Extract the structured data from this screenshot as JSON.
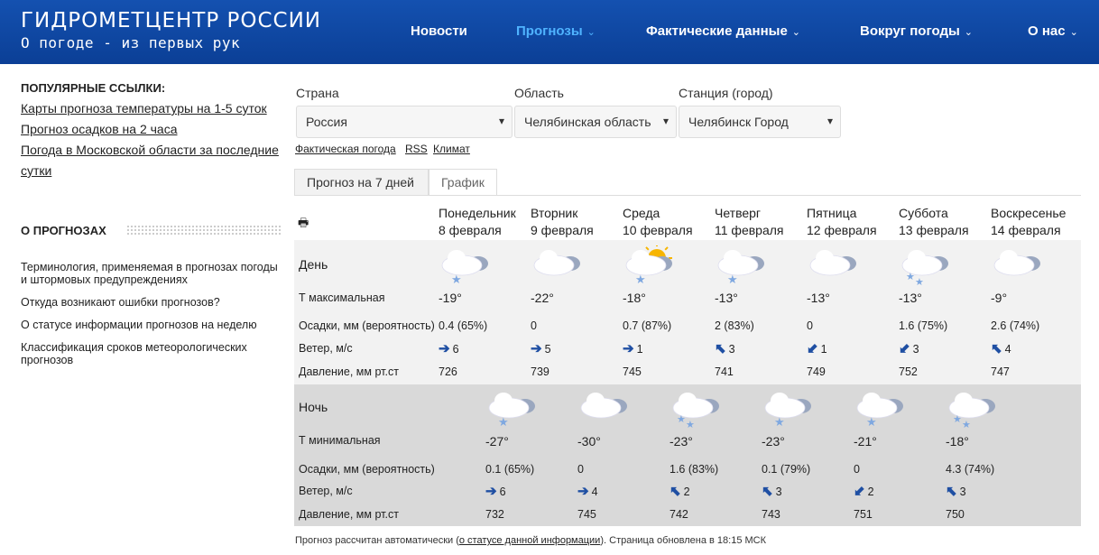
{
  "header": {
    "logo_title": "ГИДРОМЕТЦЕНТР РОССИИ",
    "logo_subtitle": "О погоде - из первых рук",
    "nav": [
      {
        "label": "Новости",
        "chev": ""
      },
      {
        "label": "Прогнозы",
        "chev": "⌄"
      },
      {
        "label": "Фактические данные",
        "chev": "⌄"
      },
      {
        "label": "Вокруг погоды",
        "chev": "⌄"
      },
      {
        "label": "О нас",
        "chev": "⌄"
      }
    ]
  },
  "sidebar": {
    "popular_title": "ПОПУЛЯРНЫЕ ССЫЛКИ:",
    "popular_links": [
      "Карты прогноза температуры на 1-5 суток",
      "Прогноз осадков на 2 часа",
      "Погода в Московской области за последние сутки"
    ],
    "about_title": "О ПРОГНОЗАХ",
    "about_links": [
      "Терминология, применяемая в прогнозах погоды и штормовых предупреждениях",
      "Откуда возникают ошибки прогнозов?",
      "О статусе информации прогнозов на неделю",
      "Классификация сроков метеорологических прогнозов"
    ]
  },
  "filters": {
    "country_label": "Страна",
    "country_value": "Россия",
    "region_label": "Область",
    "region_value": "Челябинская область",
    "station_label": "Станция (город)",
    "station_value": "Челябинск Город"
  },
  "links": {
    "actual": "Фактическая погода",
    "rss": "RSS",
    "climate": "Климат"
  },
  "tabs": {
    "forecast": "Прогноз на 7 дней",
    "chart": "График"
  },
  "days": [
    {
      "name": "Понедельник",
      "date": "8 февраля",
      "tmax": "-19°",
      "precip": "0.4 (65%)",
      "wind": "6",
      "wind_arrow": "➔",
      "pressure": "726",
      "icon": "cloud-snow"
    },
    {
      "name": "Вторник",
      "date": "9 февраля",
      "tmax": "-22°",
      "precip": "0",
      "wind": "5",
      "wind_arrow": "➔",
      "pressure": "739",
      "icon": "cloud"
    },
    {
      "name": "Среда",
      "date": "10 февраля",
      "tmax": "-18°",
      "precip": "0.7 (87%)",
      "wind": "1",
      "wind_arrow": "➔",
      "pressure": "745",
      "icon": "sun-cloud-snow"
    },
    {
      "name": "Четверг",
      "date": "11 февраля",
      "tmax": "-13°",
      "precip": "2 (83%)",
      "wind": "3",
      "wind_arrow": "⬉",
      "pressure": "741",
      "icon": "cloud-snow"
    },
    {
      "name": "Пятница",
      "date": "12 февраля",
      "tmax": "-13°",
      "precip": "0",
      "wind": "1",
      "wind_arrow": "⬋",
      "pressure": "749",
      "icon": "cloud"
    },
    {
      "name": "Суббота",
      "date": "13 февраля",
      "tmax": "-13°",
      "precip": "1.6 (75%)",
      "wind": "3",
      "wind_arrow": "⬋",
      "pressure": "752",
      "icon": "cloud-snow2"
    },
    {
      "name": "Воскресенье",
      "date": "14 февраля",
      "tmax": "-9°",
      "precip": "2.6 (74%)",
      "wind": "4",
      "wind_arrow": "⬉",
      "pressure": "747",
      "icon": "cloud"
    }
  ],
  "nights": [
    {
      "tmin": "-27°",
      "precip": "0.1 (65%)",
      "wind": "6",
      "wind_arrow": "➔",
      "pressure": "732",
      "icon": "cloud-snow"
    },
    {
      "tmin": "-30°",
      "precip": "0",
      "wind": "4",
      "wind_arrow": "➔",
      "pressure": "745",
      "icon": "moon-cloud"
    },
    {
      "tmin": "-23°",
      "precip": "1.6 (83%)",
      "wind": "2",
      "wind_arrow": "⬉",
      "pressure": "742",
      "icon": "cloud-snow2"
    },
    {
      "tmin": "-23°",
      "precip": "0.1 (79%)",
      "wind": "3",
      "wind_arrow": "⬉",
      "pressure": "743",
      "icon": "cloud-snow"
    },
    {
      "tmin": "-21°",
      "precip": "0",
      "wind": "2",
      "wind_arrow": "⬋",
      "pressure": "751",
      "icon": "cloud-snow"
    },
    {
      "tmin": "-18°",
      "precip": "4.3 (74%)",
      "wind": "3",
      "wind_arrow": "⬉",
      "pressure": "750",
      "icon": "cloud-snow2"
    }
  ],
  "row_labels": {
    "day": "День",
    "tmax": "Т максимальная",
    "precip": "Осадки, мм (вероятность)",
    "wind": "Ветер, м/с",
    "pressure": "Давление, мм рт.ст",
    "night": "Ночь",
    "tmin": "Т минимальная"
  },
  "footer": {
    "before": "Прогноз рассчитан автоматически (",
    "link": "о статусе данной информации",
    "after": "). Страница обновлена в 18:15 МСК"
  }
}
